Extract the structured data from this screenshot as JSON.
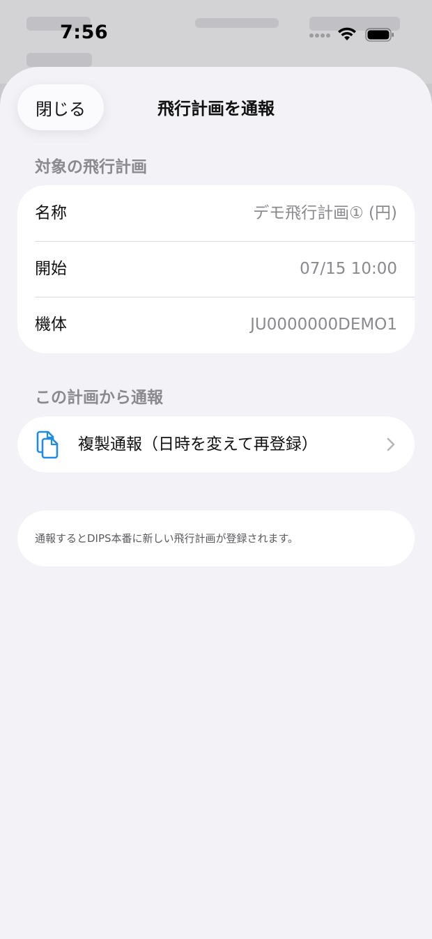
{
  "status_bar": {
    "time": "7:56"
  },
  "sheet": {
    "close_label": "閉じる",
    "title": "飛行計画を通報"
  },
  "target_plan": {
    "header": "対象の飛行計画",
    "rows": [
      {
        "label": "名称",
        "value": "デモ飛行計画① (円)"
      },
      {
        "label": "開始",
        "value": "07/15 10:00"
      },
      {
        "label": "機体",
        "value": "JU0000000DEMO1"
      }
    ]
  },
  "report_from_plan": {
    "header": "この計画から通報",
    "action_label": "複製通報（日時を変えて再登録）",
    "action_icon": "doc-on-doc-icon"
  },
  "note": {
    "text": "通報するとDIPS本番に新しい飛行計画が登録されます。"
  },
  "colors": {
    "accent": "#1E8CE6",
    "secondary_text": "#8A8A8E",
    "sheet_background": "#F2F2F7",
    "card_background": "#FFFFFF"
  }
}
